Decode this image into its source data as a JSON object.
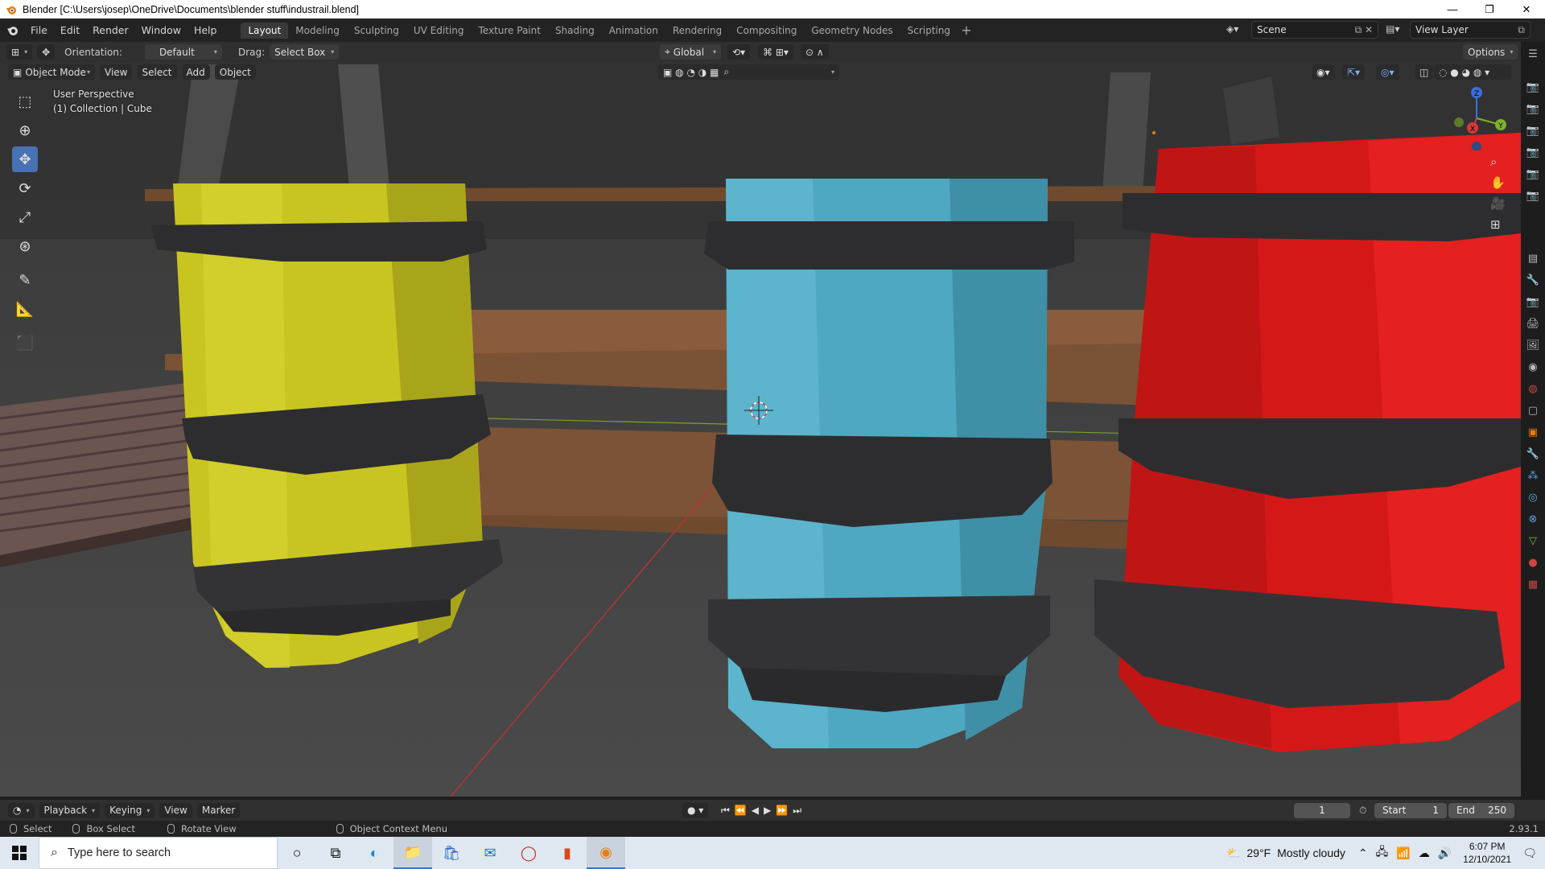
{
  "window": {
    "title": "Blender [C:\\Users\\josep\\OneDrive\\Documents\\blender stuff\\industrail.blend]",
    "minimize": "—",
    "maximize": "❐",
    "close": "✕"
  },
  "menu": [
    "File",
    "Edit",
    "Render",
    "Window",
    "Help"
  ],
  "workspaces": [
    {
      "label": "Layout",
      "active": true
    },
    {
      "label": "Modeling"
    },
    {
      "label": "Sculpting"
    },
    {
      "label": "UV Editing"
    },
    {
      "label": "Texture Paint"
    },
    {
      "label": "Shading"
    },
    {
      "label": "Animation"
    },
    {
      "label": "Rendering"
    },
    {
      "label": "Compositing"
    },
    {
      "label": "Geometry Nodes"
    },
    {
      "label": "Scripting"
    }
  ],
  "scene": {
    "name": "Scene",
    "view_layer": "View Layer"
  },
  "tool_header": {
    "orientation_label": "Orientation:",
    "orientation_value": "Default",
    "drag_label": "Drag:",
    "drag_value": "Select Box",
    "transform_orientation": "Global",
    "options": "Options"
  },
  "viewport_header": {
    "mode": "Object Mode",
    "menus": [
      "View",
      "Select",
      "Add",
      "Object"
    ]
  },
  "viewport": {
    "perspective": "User Perspective",
    "collection": "(1) Collection | Cube",
    "gizmo": {
      "x": "X",
      "y": "Y",
      "z": "Z"
    },
    "colors": {
      "yellow": "#c9c520",
      "cyan": "#4fa8c2",
      "red": "#d41818",
      "band": "#2d2d2f",
      "wood": "#7a5235",
      "floor": "#3d3d3d"
    }
  },
  "tools": [
    "select-box-icon",
    "cursor-icon",
    "move-icon",
    "rotate-icon",
    "scale-icon",
    "transform-icon",
    "annotate-icon",
    "measure-icon",
    "add-cube-icon"
  ],
  "timeline": {
    "menus": [
      "Playback",
      "Keying",
      "View",
      "Marker"
    ],
    "current_frame": "1",
    "start_label": "Start",
    "start": "1",
    "end_label": "End",
    "end": "250"
  },
  "statusbar": {
    "select": "Select",
    "box_select": "Box Select",
    "rotate_view": "Rotate View",
    "context_menu": "Object Context Menu",
    "version": "2.93.1"
  },
  "taskbar": {
    "search_placeholder": "Type here to search",
    "weather_temp": "29°F",
    "weather_desc": "Mostly cloudy",
    "time": "6:07 PM",
    "date": "12/10/2021"
  }
}
